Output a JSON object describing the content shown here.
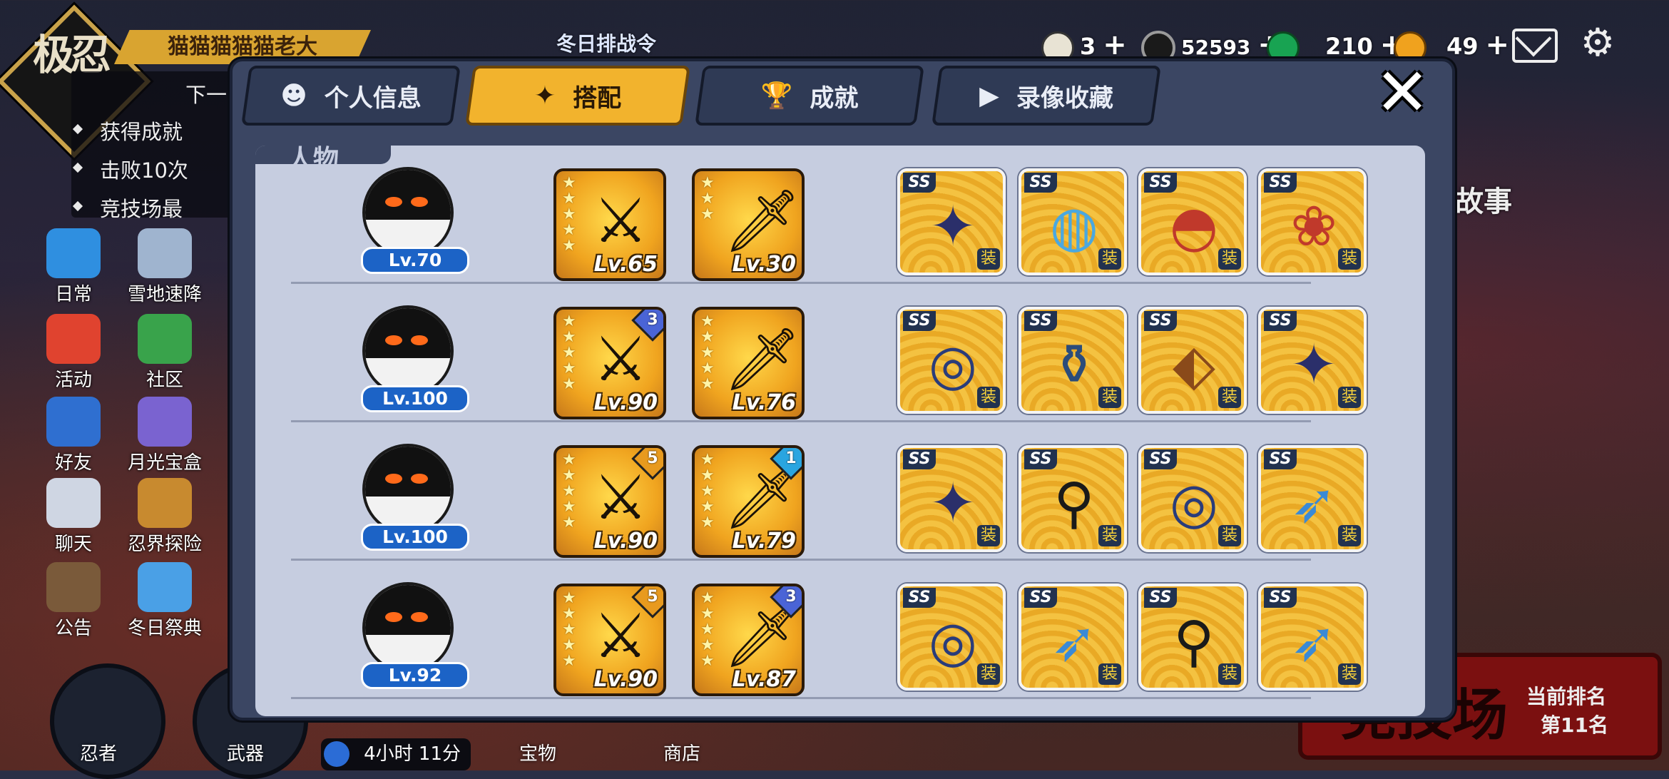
{
  "logo": {
    "text": "极忍"
  },
  "player_name": "猫猫猫猫猫老大",
  "tasks": {
    "next_label": "下一",
    "items": [
      "获得成就",
      "击败10次",
      "竞技场最"
    ]
  },
  "left_menu": [
    {
      "id": "daily",
      "label": "日常",
      "color": "#2f8fe0"
    },
    {
      "id": "snow",
      "label": "雪地速降",
      "color": "#9fb4cf"
    },
    {
      "id": "event",
      "label": "活动",
      "color": "#e0432f"
    },
    {
      "id": "community",
      "label": "社区",
      "color": "#39a34b"
    },
    {
      "id": "friends",
      "label": "好友",
      "color": "#2f6fd0"
    },
    {
      "id": "moonbox",
      "label": "月光宝盒",
      "color": "#7a63d0"
    },
    {
      "id": "chat",
      "label": "聊天",
      "color": "#cfd6e3"
    },
    {
      "id": "adventure",
      "label": "忍界探险",
      "color": "#c88a2f"
    },
    {
      "id": "notice",
      "label": "公告",
      "color": "#7a5a3a"
    },
    {
      "id": "winter",
      "label": "冬日祭典",
      "color": "#4aa0e6"
    }
  ],
  "resources": {
    "onigiri": "3",
    "coins": "52593",
    "green": "210",
    "gold": "49"
  },
  "banner_top": "冬日排战令",
  "story_label": "故事",
  "rank": {
    "big_text": "竞技场",
    "label": "当前排名",
    "value": "第11名"
  },
  "timer": "4小时 11分",
  "bottom_nav": [
    "忍者",
    "武器",
    "宝物",
    "商店"
  ],
  "tabs": [
    {
      "label": "个人信息",
      "icon": "avatar-icon",
      "active": false
    },
    {
      "label": "搭配",
      "icon": "shuriken-icon",
      "active": true
    },
    {
      "label": "成就",
      "icon": "trophy-icon",
      "active": false
    },
    {
      "label": "录像收藏",
      "icon": "play-icon",
      "active": false
    }
  ],
  "panel_title": "人物",
  "ninjas": [
    {
      "level": "Lv.70",
      "weapons": [
        {
          "level": "Lv.65",
          "stars": 5,
          "badge": ""
        },
        {
          "level": "Lv.30",
          "stars": 3,
          "badge": ""
        }
      ],
      "items": [
        {
          "grade": "SS",
          "icon": "shuriken"
        },
        {
          "grade": "SS",
          "icon": "mirror"
        },
        {
          "grade": "SS",
          "icon": "fan"
        },
        {
          "grade": "SS",
          "icon": "bells"
        }
      ]
    },
    {
      "level": "Lv.100",
      "weapons": [
        {
          "level": "Lv.90",
          "stars": 5,
          "badge": "3"
        },
        {
          "level": "Lv.76",
          "stars": 5,
          "badge": ""
        }
      ],
      "items": [
        {
          "grade": "SS",
          "icon": "ring"
        },
        {
          "grade": "SS",
          "icon": "gourd"
        },
        {
          "grade": "SS",
          "icon": "boot"
        },
        {
          "grade": "SS",
          "icon": "shuriken"
        }
      ]
    },
    {
      "level": "Lv.100",
      "weapons": [
        {
          "level": "Lv.90",
          "stars": 5,
          "badge": "5"
        },
        {
          "level": "Lv.79",
          "stars": 5,
          "badge": "1"
        }
      ],
      "items": [
        {
          "grade": "SS",
          "icon": "shuriken"
        },
        {
          "grade": "SS",
          "icon": "scroll"
        },
        {
          "grade": "SS",
          "icon": "ring"
        },
        {
          "grade": "SS",
          "icon": "kunai"
        }
      ]
    },
    {
      "level": "Lv.92",
      "weapons": [
        {
          "level": "Lv.90",
          "stars": 5,
          "badge": "5"
        },
        {
          "level": "Lv.87",
          "stars": 5,
          "badge": "3"
        }
      ],
      "items": [
        {
          "grade": "SS",
          "icon": "ring"
        },
        {
          "grade": "SS",
          "icon": "kunai"
        },
        {
          "grade": "SS",
          "icon": "scroll"
        },
        {
          "grade": "SS",
          "icon": "kunai"
        }
      ]
    }
  ],
  "equip_label": "装"
}
